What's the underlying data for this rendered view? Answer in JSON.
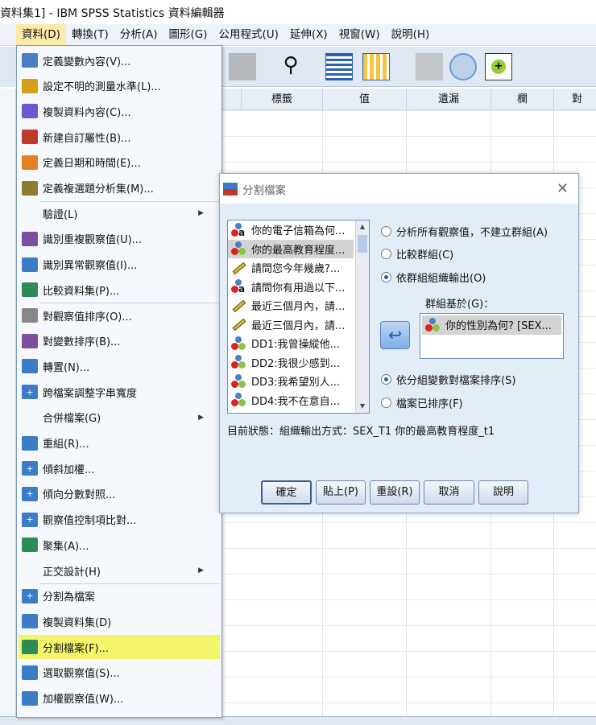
{
  "window": {
    "title": "資料集1] - IBM SPSS Statistics 資料編輯器"
  },
  "menubar": [
    {
      "label": "資料(D)"
    },
    {
      "label": "轉換(T)"
    },
    {
      "label": "分析(A)"
    },
    {
      "label": "圖形(G)"
    },
    {
      "label": "公用程式(U)"
    },
    {
      "label": "延伸(X)"
    },
    {
      "label": "視窗(W)"
    },
    {
      "label": "說明(H)"
    }
  ],
  "grid": {
    "columns": [
      "標籤",
      "值",
      "遺漏",
      "欄",
      "對"
    ]
  },
  "data_menu": {
    "items": [
      {
        "label": "定義變數內容(V)...",
        "icon": "define-variable-icon",
        "color": "#4a7fc1"
      },
      {
        "label": "設定不明的測量水準(L)...",
        "icon": "measure-level-icon",
        "color": "#d4a017"
      },
      {
        "label": "複製資料內容(C)...",
        "icon": "copy-properties-icon",
        "color": "#6a5acd"
      },
      {
        "label": "新建自訂屬性(B)...",
        "icon": "custom-attribute-icon",
        "color": "#c0392b"
      },
      {
        "label": "定義日期和時間(E)...",
        "icon": "date-time-icon",
        "color": "#e67e22"
      },
      {
        "label": "定義複選題分析集(M)...",
        "icon": "multiple-response-icon",
        "color": "#8e7b2e"
      },
      {
        "label": "驗證(L)",
        "submenu": true
      },
      {
        "label": "識別重複觀察值(U)...",
        "icon": "duplicate-cases-icon",
        "color": "#7b4f9e"
      },
      {
        "label": "識別異常觀察值(I)...",
        "icon": "unusual-cases-icon",
        "color": "#3c7cc7"
      },
      {
        "label": "比較資料集(P)...",
        "icon": "compare-datasets-icon",
        "color": "#2e8b57"
      },
      {
        "label": "對觀察值排序(O)...",
        "icon": "sort-cases-icon",
        "color": "#888888"
      },
      {
        "label": "對變數排序(B)...",
        "icon": "sort-variables-icon",
        "color": "#7b4f9e"
      },
      {
        "label": "轉置(N)...",
        "icon": "transpose-icon",
        "color": "#3c7cc7"
      },
      {
        "label": "跨檔案調整字串寬度",
        "icon": "plus-icon",
        "color": "#3c7cc7"
      },
      {
        "label": "合併檔案(G)",
        "submenu": true
      },
      {
        "label": "重組(R)...",
        "icon": "restructure-icon",
        "color": "#3c7cc7"
      },
      {
        "label": "傾斜加權...",
        "icon": "plus-icon",
        "color": "#3c7cc7"
      },
      {
        "label": "傾向分數對照...",
        "icon": "plus-icon",
        "color": "#3c7cc7"
      },
      {
        "label": "觀察值控制項比對...",
        "icon": "plus-icon",
        "color": "#3c7cc7"
      },
      {
        "label": "聚集(A)...",
        "icon": "aggregate-icon",
        "color": "#2e8b57"
      },
      {
        "label": "正交設計(H)",
        "submenu": true
      },
      {
        "label": "分割為檔案",
        "icon": "plus-icon",
        "color": "#3c7cc7"
      },
      {
        "label": "複製資料集(D)",
        "icon": "copy-dataset-icon",
        "color": "#3c7cc7"
      },
      {
        "label": "分割檔案(F)...",
        "icon": "split-file-icon",
        "color": "#2e8b57",
        "highlighted": true
      },
      {
        "label": "選取觀察值(S)...",
        "icon": "select-cases-icon",
        "color": "#3c7cc7"
      },
      {
        "label": "加權觀察值(W)...",
        "icon": "weight-cases-icon",
        "color": "#3c7cc7"
      }
    ]
  },
  "dialog": {
    "title": "分割檔案",
    "variables": [
      {
        "label": "你的電子信箱為何...",
        "type": "nominal-string"
      },
      {
        "label": "你的最高教育程度...",
        "type": "nominal",
        "selected": true
      },
      {
        "label": "請問您今年幾歲?...",
        "type": "scale"
      },
      {
        "label": "請問你有用過以下...",
        "type": "nominal-string"
      },
      {
        "label": "最近三個月內，請...",
        "type": "scale"
      },
      {
        "label": "最近三個月內，請...",
        "type": "scale"
      },
      {
        "label": "DD1:我曾操縱他...",
        "type": "nominal"
      },
      {
        "label": "DD2:我很少感到...",
        "type": "nominal"
      },
      {
        "label": "DD3:我希望別人...",
        "type": "nominal"
      },
      {
        "label": "DD4:我不在意自...",
        "type": "nominal"
      }
    ],
    "mode_options": [
      {
        "label": "分析所有觀察值，不建立群組(A)",
        "checked": false
      },
      {
        "label": "比較群組(C)",
        "checked": false
      },
      {
        "label": "依群組組織輸出(O)",
        "checked": true
      }
    ],
    "groups_label": "群組基於(G)：",
    "groups": [
      "你的性別為何? [SEX..."
    ],
    "sort_options": [
      {
        "label": "依分組變數對檔案排序(S)",
        "checked": true
      },
      {
        "label": "檔案已排序(F)",
        "checked": false
      }
    ],
    "status": "目前狀態：組織輸出方式：SEX_T1 你的最高教育程度_t1",
    "buttons": {
      "ok": "確定",
      "paste": "貼上(P)",
      "reset": "重設(R)",
      "cancel": "取消",
      "help": "說明"
    }
  }
}
